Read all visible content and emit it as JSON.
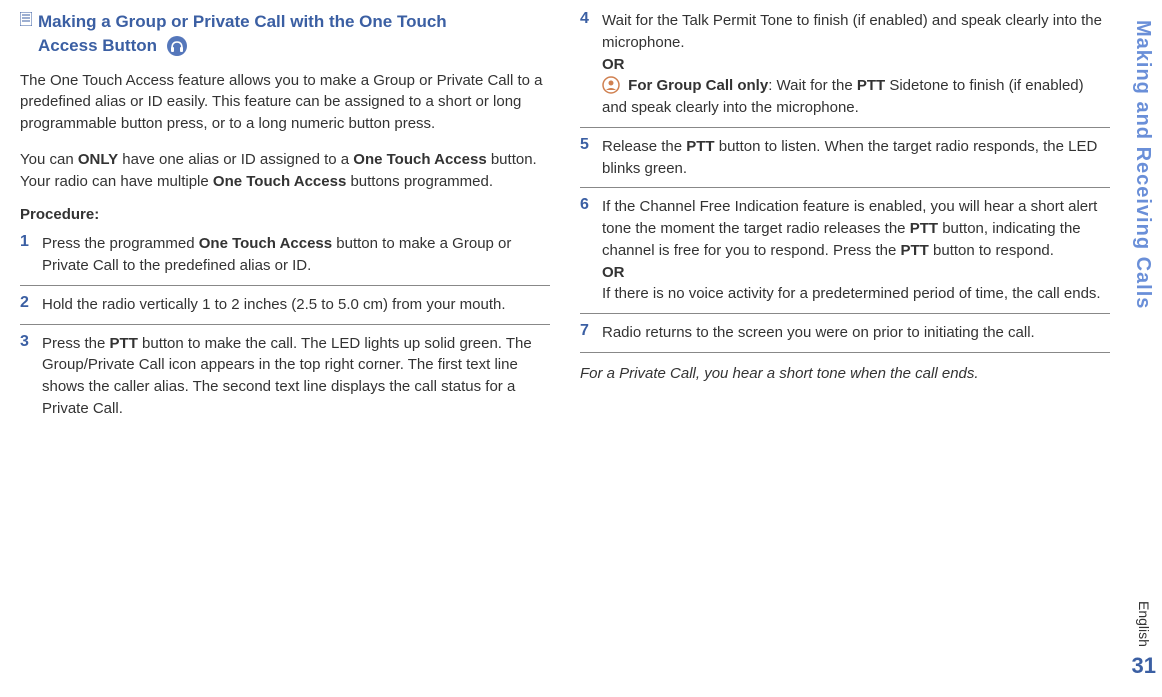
{
  "section_title_line1": "Making a Group or Private Call with the One Touch",
  "section_title_line2": "Access Button",
  "intro_para": "The One Touch Access feature allows you to make a Group or Private Call to a predefined alias or ID easily. This feature can be assigned to a short or long programmable button press, or to a long numeric button press.",
  "para2_before": "You can ",
  "para2_only": "ONLY",
  "para2_mid1": " have one alias or ID assigned to a ",
  "para2_ota1": "One Touch Access",
  "para2_mid2": " button. Your radio can have multiple ",
  "para2_ota2": "One Touch Access",
  "para2_end": " buttons programmed.",
  "procedure_label": "Procedure:",
  "step1_num": "1",
  "step1_before": "Press the programmed ",
  "step1_bold": "One Touch Access",
  "step1_after": " button to make a Group or Private Call to the predefined alias or ID.",
  "step2_num": "2",
  "step2_text": "Hold the radio vertically 1 to 2 inches (2.5 to 5.0 cm) from your mouth.",
  "step3_num": "3",
  "step3_before": "Press the ",
  "step3_bold": "PTT",
  "step3_after": " button to make the call. The LED lights up solid green. The Group/Private Call icon appears in the top right corner. The first text line shows the caller alias. The second text line displays the call status for a Private Call.",
  "step4_num": "4",
  "step4_line1": "Wait for the Talk Permit Tone to finish (if enabled) and speak clearly into the microphone.",
  "step4_or": "OR",
  "step4_group_bold": "For Group Call only",
  "step4_group_mid": ": Wait for the ",
  "step4_ptt": "PTT",
  "step4_group_end": " Sidetone to finish (if enabled) and speak clearly into the microphone.",
  "step5_num": "5",
  "step5_before": "Release the ",
  "step5_bold": "PTT",
  "step5_after": " button to listen. When the target radio responds, the LED blinks green.",
  "step6_num": "6",
  "step6_part1": "If the Channel Free Indication feature is enabled, you will hear a short alert tone the moment the target radio releases the ",
  "step6_ptt1": "PTT",
  "step6_part2": " button, indicating the channel is free for you to respond. Press the ",
  "step6_ptt2": "PTT",
  "step6_part3": " button to respond.",
  "step6_or": "OR",
  "step6_part4": "If there is no voice activity for a predetermined period of time, the call ends.",
  "step7_num": "7",
  "step7_text": "Radio returns to the screen you were on prior to initiating the call.",
  "note": "For a Private Call, you hear a short tone when the call ends.",
  "side_title": "Making and Receiving Calls",
  "english_label": "English",
  "page_num": "31"
}
